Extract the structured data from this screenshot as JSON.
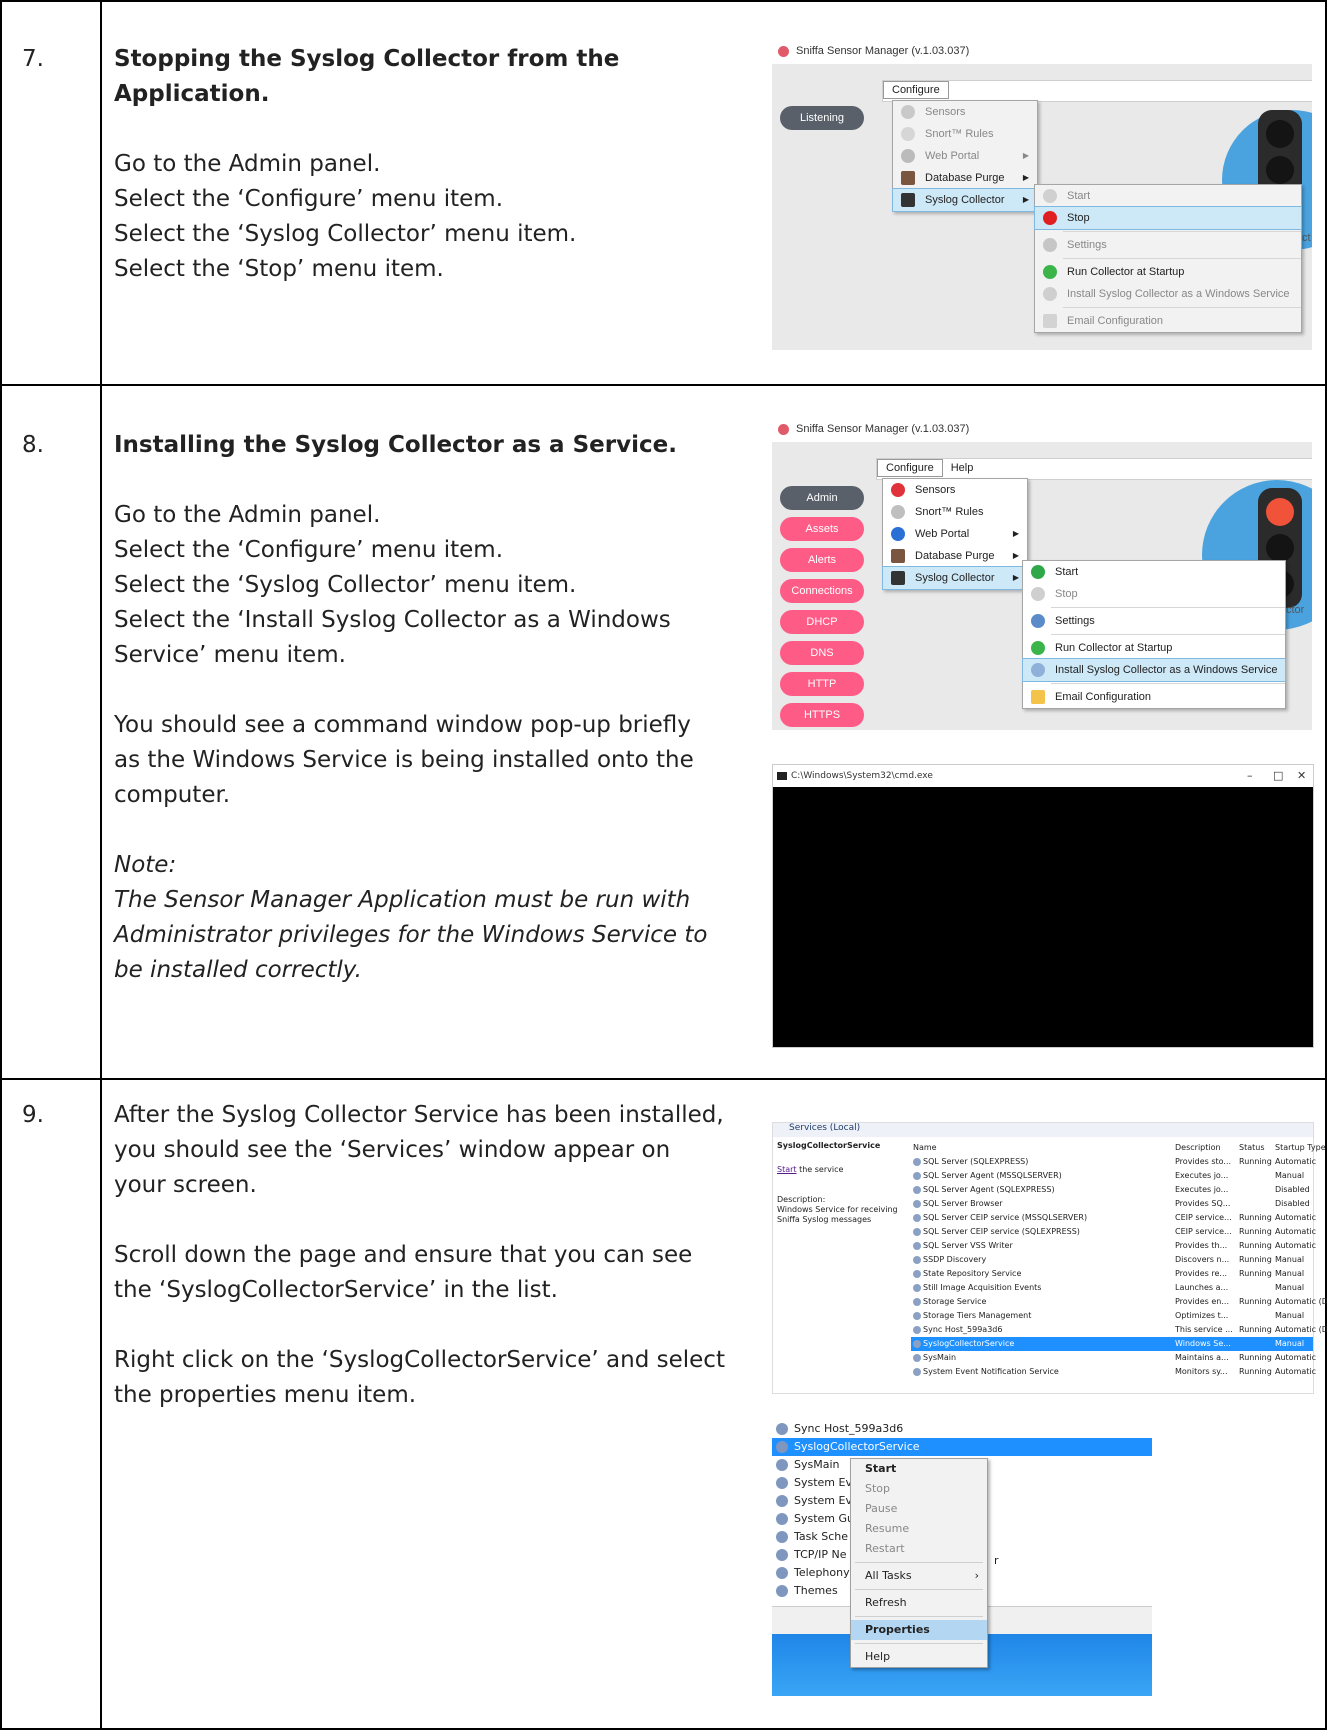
{
  "steps": [
    {
      "number": "7.",
      "title": "Stopping the Syslog Collector from the Application.",
      "lines": [
        "Go to the Admin panel.",
        "Select the ‘Configure’ menu item.",
        "Select the ‘Syslog Collector’ menu item.",
        "Select the ‘Stop’ menu item."
      ]
    },
    {
      "number": "8.",
      "title": "Installing the Syslog Collector as a Service.",
      "lines": [
        "Go to the Admin panel.",
        "Select the ‘Configure’ menu item.",
        "Select the ‘Syslog Collector’ menu item.",
        "Select the ‘Install Syslog Collector as a Windows",
        "Service’ menu item."
      ],
      "para2": [
        "You should see a command window pop-up briefly",
        "as the Windows Service is being installed onto the",
        "computer."
      ],
      "note_label": "Note:",
      "note_lines": [
        "The Sensor Manager Application must be run with",
        "Administrator privileges for the Windows Service to",
        "be installed correctly."
      ]
    },
    {
      "number": "9.",
      "para1": [
        "After the Syslog Collector Service has been installed,",
        "you should see the ‘Services’ window appear on",
        "your screen."
      ],
      "para2": [
        "Scroll down the page and ensure that you can see",
        "the ‘SyslogCollectorService’ in the list."
      ],
      "para3": [
        "Right click on the ‘SyslogCollectorService’ and select",
        "the properties menu item."
      ]
    }
  ],
  "app": {
    "title": "Sniffa Sensor Manager (v.1.03.037)",
    "listening": "Listening",
    "admin": "Admin",
    "nav_buttons": [
      "Assets",
      "Alerts",
      "Connections",
      "DHCP",
      "DNS",
      "HTTP",
      "HTTPS"
    ],
    "menubar": [
      "Configure",
      "Help"
    ],
    "configure_items": [
      "Sensors",
      "Snort™ Rules",
      "Web Portal",
      "Database Purge",
      "Syslog Collector"
    ],
    "syslog_items": [
      "Start",
      "Stop",
      "Settings",
      "Run Collector at Startup",
      "Install Syslog Collector as a Windows Service",
      "Email Configuration"
    ],
    "partial_label_1": "ct",
    "partial_label_2": "ctor"
  },
  "cmd": {
    "title": "C:\\Windows\\System32\\cmd.exe",
    "controls": [
      "–",
      "□",
      "✕"
    ]
  },
  "services": {
    "header": "Services (Local)",
    "selected_name": "SyslogCollectorService",
    "start_link": "Start",
    "start_rest": " the service",
    "description_label": "Description:",
    "description": "Windows Service for receiving Sniffa Syslog messages",
    "columns": [
      "Name",
      "Description",
      "Status",
      "Startup Type"
    ],
    "rows": [
      [
        "SQL Server (SQLEXPRESS)",
        "Provides sto...",
        "Running",
        "Automatic"
      ],
      [
        "SQL Server Agent (MSSQLSERVER)",
        "Executes jo...",
        "",
        "Manual"
      ],
      [
        "SQL Server Agent (SQLEXPRESS)",
        "Executes jo...",
        "",
        "Disabled"
      ],
      [
        "SQL Server Browser",
        "Provides SQ...",
        "",
        "Disabled"
      ],
      [
        "SQL Server CEIP service (MSSQLSERVER)",
        "CEIP service...",
        "Running",
        "Automatic"
      ],
      [
        "SQL Server CEIP service (SQLEXPRESS)",
        "CEIP service...",
        "Running",
        "Automatic"
      ],
      [
        "SQL Server VSS Writer",
        "Provides th...",
        "Running",
        "Automatic"
      ],
      [
        "SSDP Discovery",
        "Discovers n...",
        "Running",
        "Manual"
      ],
      [
        "State Repository Service",
        "Provides re...",
        "Running",
        "Manual"
      ],
      [
        "Still Image Acquisition Events",
        "Launches a...",
        "",
        "Manual"
      ],
      [
        "Storage Service",
        "Provides en...",
        "Running",
        "Automatic (D..."
      ],
      [
        "Storage Tiers Management",
        "Optimizes t...",
        "",
        "Manual"
      ],
      [
        "Sync Host_599a3d6",
        "This service ...",
        "Running",
        "Automatic (D..."
      ],
      [
        "SyslogCollectorService",
        "Windows Se...",
        "",
        "Manual"
      ],
      [
        "SysMain",
        "Maintains a...",
        "Running",
        "Automatic"
      ],
      [
        "System Event Notification Service",
        "Monitors sy...",
        "Running",
        "Automatic"
      ]
    ]
  },
  "context": {
    "rows": [
      "Sync Host_599a3d6",
      "SyslogCollectorService",
      "SysMain",
      "System Ev",
      "System Ev",
      "System Gu",
      "Task Sche",
      "TCP/IP Ne",
      "Telephony",
      "Themes"
    ],
    "menu": [
      "Start",
      "Stop",
      "Pause",
      "Resume",
      "Restart",
      "All Tasks",
      "Refresh",
      "Properties",
      "Help"
    ],
    "trailing": "r"
  }
}
